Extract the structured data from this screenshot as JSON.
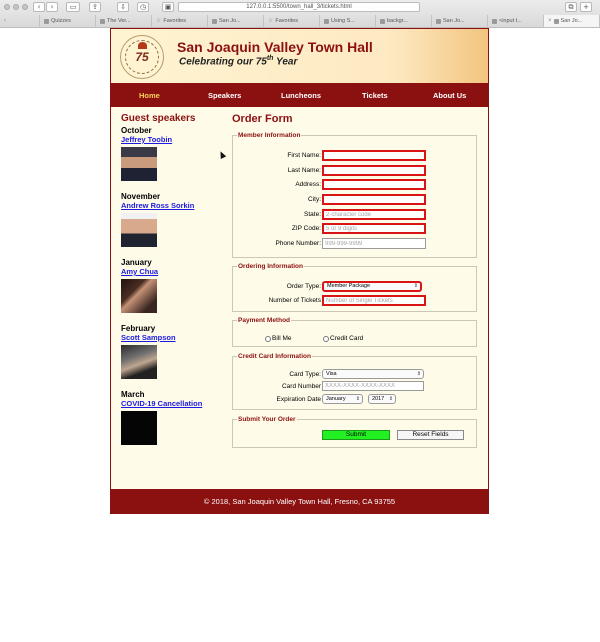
{
  "browser": {
    "url": "127.0.0.1:5500/town_hall_3/tickets.html",
    "tabs": [
      "Quizzes",
      "The Ver...",
      "Favorites",
      "San Jo...",
      "Favorites",
      "Using S...",
      "backgr...",
      "San Jo...",
      "<input t...",
      "San Jo..."
    ]
  },
  "header": {
    "logo_text": "75",
    "title": "San Joaquin Valley Town Hall",
    "subtitle_prefix": "Celebrating our ",
    "subtitle_num": "75",
    "subtitle_sup": "th",
    "subtitle_suffix": " Year"
  },
  "nav": [
    "Home",
    "Speakers",
    "Luncheons",
    "Tickets",
    "About Us"
  ],
  "sidebar": {
    "title": "Guest speakers",
    "speakers": [
      {
        "month": "October",
        "name": "Jeffrey Toobin"
      },
      {
        "month": "November",
        "name": "Andrew Ross Sorkin"
      },
      {
        "month": "January",
        "name": "Amy Chua"
      },
      {
        "month": "February",
        "name": "Scott Sampson"
      },
      {
        "month": "March",
        "name": "COVID-19 Cancellation"
      }
    ]
  },
  "main": {
    "title": "Order Form",
    "member": {
      "legend": "Member Information",
      "fields": [
        {
          "label": "First Name:",
          "placeholder": ""
        },
        {
          "label": "Last Name:",
          "placeholder": ""
        },
        {
          "label": "Address:",
          "placeholder": ""
        },
        {
          "label": "City:",
          "placeholder": ""
        },
        {
          "label": "State:",
          "placeholder": "2-character code"
        },
        {
          "label": "ZIP Code:",
          "placeholder": "5 or 9 digits"
        },
        {
          "label": "Phone Number:",
          "placeholder": "999-999-9999"
        }
      ]
    },
    "ordering": {
      "legend": "Ordering Information",
      "order_type_label": "Order Type:",
      "order_type_value": "Member Package",
      "num_tickets_label": "Number of Tickets",
      "num_tickets_placeholder": "Number of Single Tickets"
    },
    "payment": {
      "legend": "Payment Method",
      "options": [
        "Bill Me",
        "Credit Card"
      ]
    },
    "card": {
      "legend": "Credit Card Information",
      "type_label": "Card Type:",
      "type_value": "Visa",
      "number_label": "Card Number",
      "number_placeholder": "XXXX-XXXX-XXXX-XXXX",
      "exp_label": "Expiration Date",
      "exp_month": "January",
      "exp_year": "2017"
    },
    "submit": {
      "legend": "Submit Your Order",
      "submit_label": "Submit",
      "reset_label": "Reset Fields"
    }
  },
  "footer": {
    "text": "© 2018, San Joaquin Valley Town Hall, Fresno, CA 93755"
  },
  "colors": {
    "brand": "#8b1010",
    "nav_active": "#f6d25a",
    "required_border": "#d91414",
    "submit_bg": "#22f022",
    "link": "#1a1ae0"
  },
  "icons": [
    "back-icon",
    "forward-icon",
    "sidebar-icon",
    "share-icon",
    "reader-icon",
    "reload-icon",
    "tabs-icon",
    "new-tab-icon"
  ]
}
